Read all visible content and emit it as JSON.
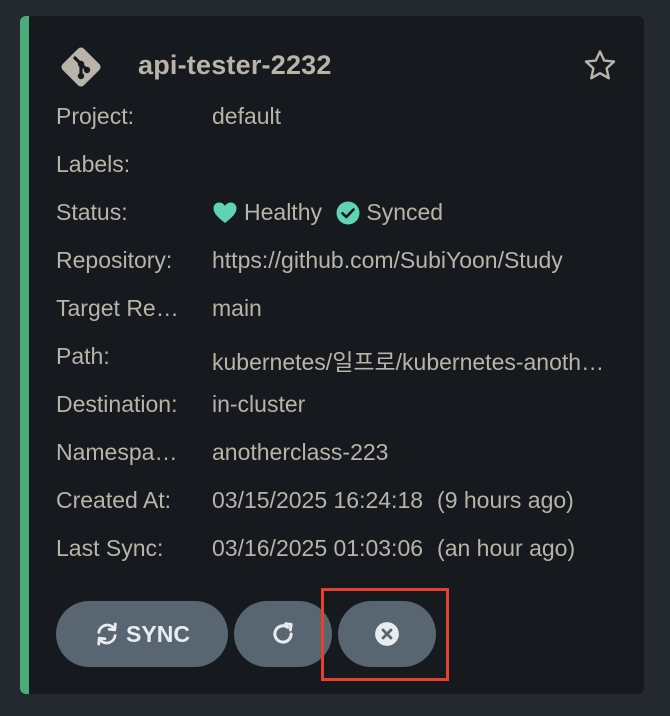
{
  "app": {
    "title": "api-tester-2232",
    "favorite_icon": "star-outline-icon",
    "app_icon": "git-icon"
  },
  "rows": {
    "project": {
      "label": "Project:",
      "value": "default"
    },
    "labels": {
      "label": "Labels:",
      "value": ""
    },
    "status": {
      "label": "Status:",
      "health": "Healthy",
      "health_icon": "heart-icon",
      "sync": "Synced",
      "sync_icon": "check-circle-icon"
    },
    "repo": {
      "label": "Repository:",
      "value": "https://github.com/SubiYoon/Study"
    },
    "target": {
      "label": "Target Revision:",
      "value": "main"
    },
    "path": {
      "label": "Path:",
      "value": "kubernetes/일프로/kubernetes-anotherclass"
    },
    "destination": {
      "label": "Destination:",
      "value": "in-cluster"
    },
    "namespace": {
      "label": "Namespace:",
      "value": "anotherclass-223"
    },
    "created": {
      "label": "Created At:",
      "value": "03/15/2025 16:24:18",
      "relative": "(9 hours ago)"
    },
    "last_sync": {
      "label": "Last Sync:",
      "value": "03/16/2025 01:03:06",
      "relative": "(an hour ago)"
    }
  },
  "buttons": {
    "sync_label": "SYNC",
    "sync_icon": "sync-icon",
    "refresh_icon": "refresh-icon",
    "delete_icon": "close-circle-icon"
  },
  "colors": {
    "accent": "#4aac7b",
    "status_green": "#5fd3b3",
    "highlight": "#e5412c",
    "button_bg": "#576670"
  }
}
